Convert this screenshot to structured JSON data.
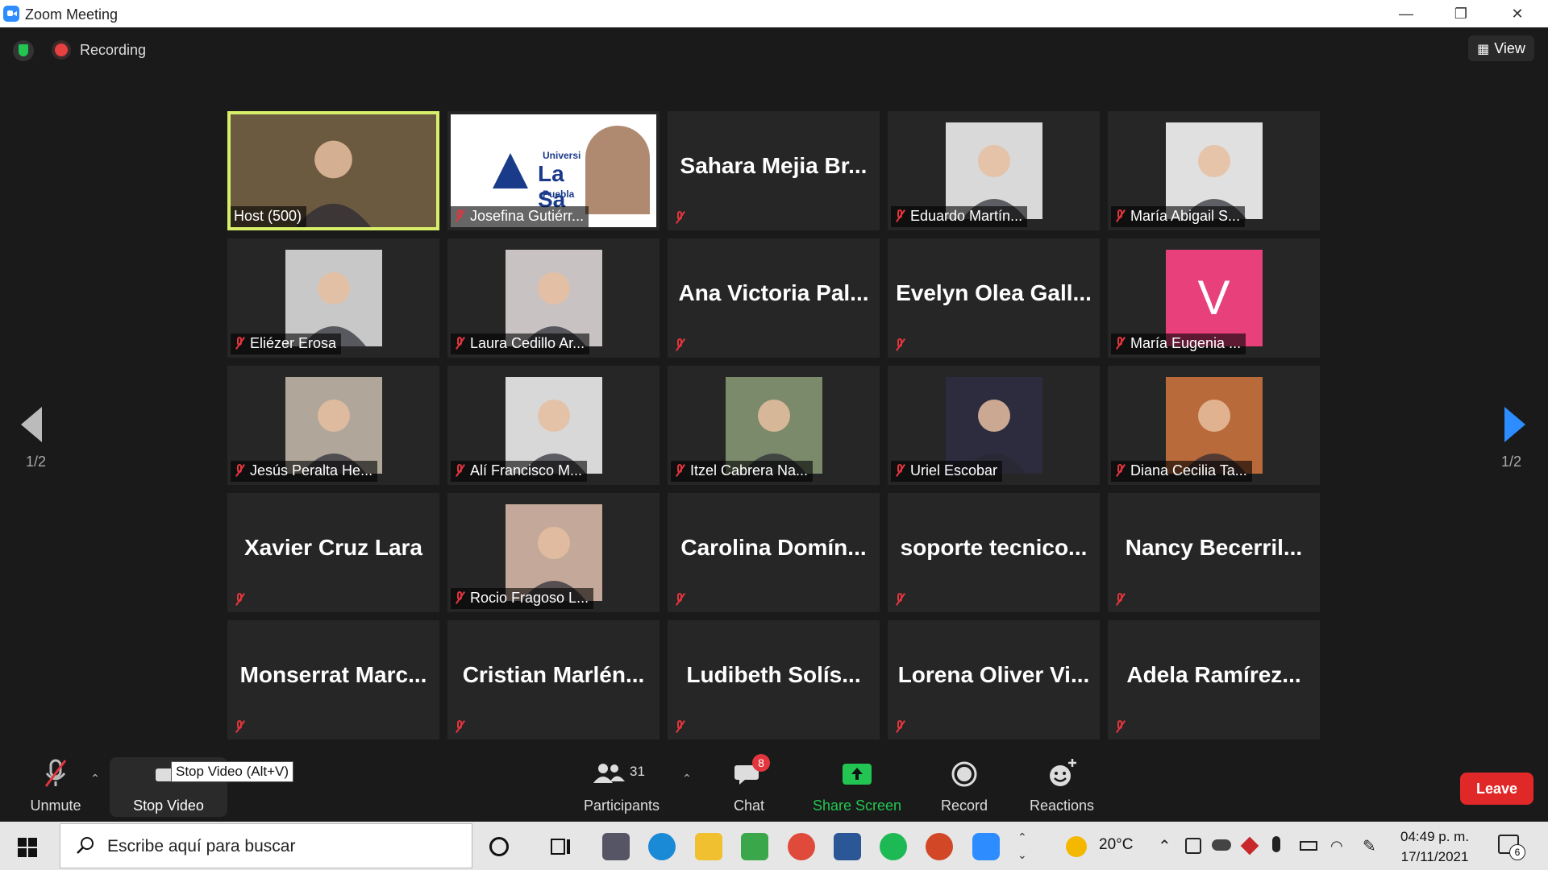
{
  "window": {
    "title": "Zoom Meeting",
    "min": "—",
    "max": "❐",
    "close": "✕"
  },
  "topbar": {
    "recording": "Recording",
    "view": "View"
  },
  "pager": {
    "left": "1/2",
    "right": "1/2"
  },
  "participants_grid": [
    {
      "name": "Host (500)",
      "type": "photo",
      "bg": "#6b5a40",
      "active": true
    },
    {
      "name": "Josefina Gutiérr...",
      "type": "logo",
      "bg": "#ffffff",
      "logo_lines": [
        "Universi",
        "La Sa",
        "Puebla"
      ]
    },
    {
      "name": "Sahara Mejia Br...",
      "type": "text"
    },
    {
      "name": "Eduardo Martín...",
      "type": "photo",
      "bg": "#d9d9d9"
    },
    {
      "name": "María Abigail S...",
      "type": "photo",
      "bg": "#e0e0e0"
    },
    {
      "name": "Eliézer Erosa",
      "type": "photo",
      "bg": "#c8c8c8"
    },
    {
      "name": "Laura Cedillo Ar...",
      "type": "photo",
      "bg": "#c9c2c2"
    },
    {
      "name": "Ana Victoria Pal...",
      "type": "text"
    },
    {
      "name": "Evelyn Olea Gall...",
      "type": "text"
    },
    {
      "name": "María Eugenia ...",
      "type": "avatar",
      "letter": "V",
      "bg": "#e8407a"
    },
    {
      "name": "Jesús Peralta He...",
      "type": "photo",
      "bg": "#b0a69a"
    },
    {
      "name": "Alí Francisco M...",
      "type": "photo",
      "bg": "#d8d8d8"
    },
    {
      "name": "Itzel Cabrera Na...",
      "type": "photo",
      "bg": "#7a8a6a"
    },
    {
      "name": "Uriel Escobar",
      "type": "photo",
      "bg": "#2c2c3e"
    },
    {
      "name": "Diana Cecilia Ta...",
      "type": "photo",
      "bg": "#b86a3a"
    },
    {
      "name": "Xavier Cruz Lara",
      "type": "text"
    },
    {
      "name": "Rocio Fragoso L...",
      "type": "photo",
      "bg": "#c4a99a"
    },
    {
      "name": "Carolina Domín...",
      "type": "text"
    },
    {
      "name": "soporte tecnico...",
      "type": "text"
    },
    {
      "name": "Nancy Becerril...",
      "type": "text"
    },
    {
      "name": "Monserrat Marc...",
      "type": "text"
    },
    {
      "name": "Cristian Marlén...",
      "type": "text"
    },
    {
      "name": "Ludibeth Solís...",
      "type": "text"
    },
    {
      "name": "Lorena Oliver Vi...",
      "type": "text"
    },
    {
      "name": "Adela Ramírez...",
      "type": "text"
    }
  ],
  "toolbar": {
    "unmute": "Unmute",
    "stop_video": "Stop Video",
    "tooltip": "Stop Video (Alt+V)",
    "participants": "Participants",
    "participants_count": "31",
    "chat": "Chat",
    "chat_badge": "8",
    "share_screen": "Share Screen",
    "record": "Record",
    "reactions": "Reactions",
    "leave": "Leave"
  },
  "taskbar": {
    "search_placeholder": "Escribe aquí para buscar",
    "temperature": "20°C",
    "time": "04:49 p. m.",
    "date": "17/11/2021",
    "notifications": "6"
  },
  "colors": {
    "accent": "#2d8cff",
    "share": "#23c552",
    "leave": "#e02828",
    "active_border": "#d8ef6a"
  }
}
